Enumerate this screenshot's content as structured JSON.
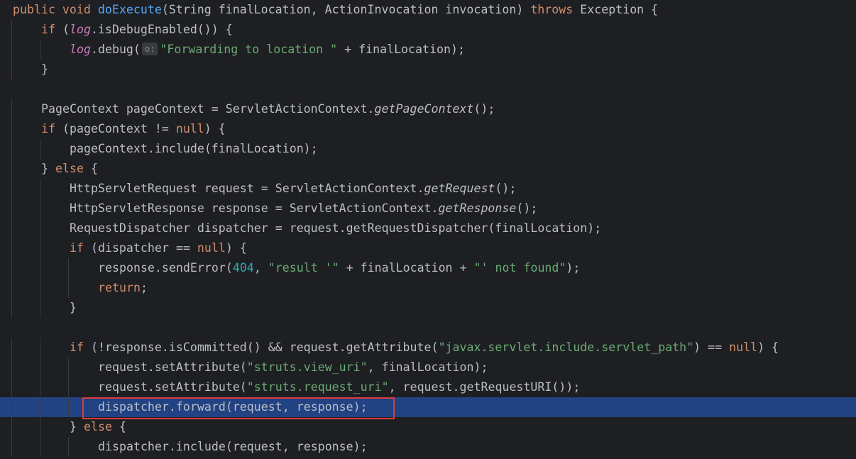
{
  "editor": {
    "lines": [
      {
        "t": [
          [
            "kw",
            "public void "
          ],
          [
            "fn",
            "doExecute"
          ],
          [
            "",
            "(String finalLocation, ActionInvocation invocation) "
          ],
          [
            "kw",
            "throws"
          ],
          [
            "",
            " Exception {"
          ]
        ]
      },
      {
        "t": [
          [
            "kw",
            "if"
          ],
          [
            "",
            " ("
          ],
          [
            "fld",
            "log"
          ],
          [
            "",
            ".isDebugEnabled()) {"
          ]
        ]
      },
      {
        "t": [
          [
            "fld",
            "log"
          ],
          [
            "",
            ".debug("
          ],
          [
            "hint",
            "o:"
          ],
          [
            "str",
            "\"Forwarding to location \""
          ],
          [
            "",
            " + finalLocation);"
          ]
        ]
      },
      {
        "t": [
          [
            "",
            "}"
          ]
        ]
      },
      {
        "t": []
      },
      {
        "t": [
          [
            "",
            "PageContext pageContext = ServletActionContext."
          ],
          [
            "it",
            "getPageContext"
          ],
          [
            "",
            "();"
          ]
        ]
      },
      {
        "t": [
          [
            "kw",
            "if"
          ],
          [
            "",
            " (pageContext != "
          ],
          [
            "kw",
            "null"
          ],
          [
            "",
            ") {"
          ]
        ]
      },
      {
        "t": [
          [
            "",
            "pageContext.include(finalLocation);"
          ]
        ]
      },
      {
        "t": [
          [
            "",
            "} "
          ],
          [
            "kw",
            "else"
          ],
          [
            "",
            " {"
          ]
        ]
      },
      {
        "t": [
          [
            "",
            "HttpServletRequest request = ServletActionContext."
          ],
          [
            "it",
            "getRequest"
          ],
          [
            "",
            "();"
          ]
        ]
      },
      {
        "t": [
          [
            "",
            "HttpServletResponse response = ServletActionContext."
          ],
          [
            "it",
            "getResponse"
          ],
          [
            "",
            "();"
          ]
        ]
      },
      {
        "t": [
          [
            "",
            "RequestDispatcher dispatcher = request.getRequestDispatcher(finalLocation);"
          ]
        ]
      },
      {
        "t": [
          [
            "kw",
            "if"
          ],
          [
            "",
            " (dispatcher == "
          ],
          [
            "kw",
            "null"
          ],
          [
            "",
            ") {"
          ]
        ]
      },
      {
        "t": [
          [
            "",
            "response.sendError("
          ],
          [
            "num",
            "404"
          ],
          [
            "",
            ", "
          ],
          [
            "str",
            "\"result '\""
          ],
          [
            "",
            " + finalLocation + "
          ],
          [
            "str",
            "\"' not found\""
          ],
          [
            "",
            ");"
          ]
        ]
      },
      {
        "t": [
          [
            "kw",
            "return"
          ],
          [
            "",
            ";"
          ]
        ]
      },
      {
        "t": [
          [
            "",
            "}"
          ]
        ]
      },
      {
        "t": []
      },
      {
        "t": [
          [
            "kw",
            "if"
          ],
          [
            "",
            " (!response.isCommitted() && request.getAttribute("
          ],
          [
            "str",
            "\"javax.servlet.include.servlet_path\""
          ],
          [
            "",
            ") == "
          ],
          [
            "kw",
            "null"
          ],
          [
            "",
            ") {"
          ]
        ]
      },
      {
        "t": [
          [
            "",
            "request.setAttribute("
          ],
          [
            "str",
            "\"struts.view_uri\""
          ],
          [
            "",
            ", finalLocation);"
          ]
        ]
      },
      {
        "t": [
          [
            "",
            "request.setAttribute("
          ],
          [
            "str",
            "\"struts.request_uri\""
          ],
          [
            "",
            ", request.getRequestURI());"
          ]
        ]
      },
      {
        "t": [
          [
            "",
            "dispatcher.forward(request, response);"
          ]
        ]
      },
      {
        "t": [
          [
            "",
            "} "
          ],
          [
            "kw",
            "else"
          ],
          [
            "",
            " {"
          ]
        ]
      },
      {
        "t": [
          [
            "",
            "dispatcher.include(request, response);"
          ]
        ]
      }
    ],
    "highlighted_line": 20,
    "colors": {
      "background": "#1e1f22",
      "keyword": "#cf8e6d",
      "method": "#56a8f5",
      "string": "#6aab73",
      "number": "#2aacb8",
      "field": "#c77dbb",
      "selection": "#214283",
      "marker": "#e03a3e"
    }
  }
}
